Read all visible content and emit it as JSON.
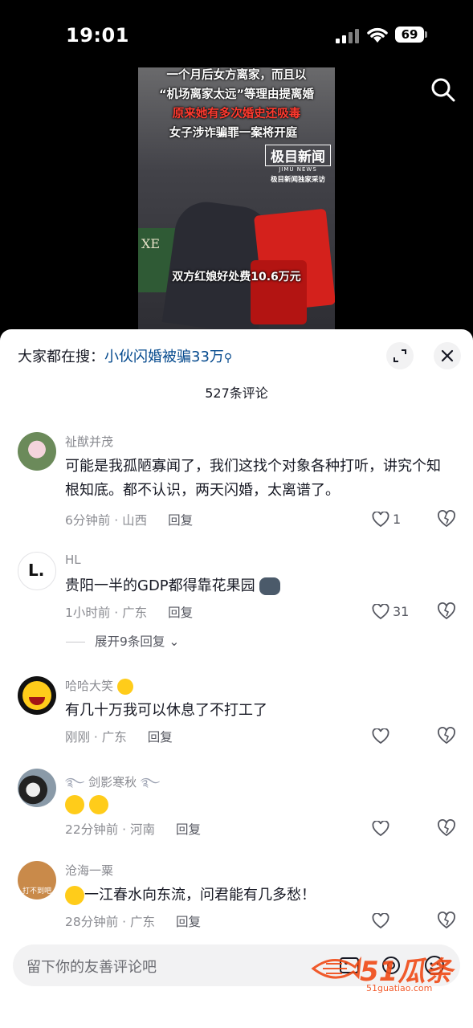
{
  "status_bar": {
    "time": "19:01",
    "battery": "69"
  },
  "video": {
    "captions": [
      "一个月后女方离家，而且以",
      "“机场离家太远”等理由提离婚",
      "原来她有多次婚史还吸毒",
      "女子涉诈骗罪一案将开庭"
    ],
    "logo_main": "极目新闻",
    "logo_en": "JIMU NEWS",
    "logo_sub": "极目新闻独家采访",
    "subtitle": "双方红娘好处费10.6万元",
    "bag_text": "XE"
  },
  "sheet": {
    "hot_prefix": "大家都在搜：",
    "hot_keyword": "小伙闪婚被骗33万",
    "comment_count": "527条评论"
  },
  "comments": [
    {
      "user": "祉猷并茂",
      "text": "可能是我孤陋寡闻了，我们这找个对象各种打听，讲究个知根知底。都不认识，两天闪婚，太离谱了。",
      "time_loc": "6分钟前 · 山西",
      "reply": "回复",
      "likes": "1"
    },
    {
      "user": "HL",
      "text": "贵阳一半的GDP都得靠花果园",
      "time_loc": "1小时前 · 广东",
      "reply": "回复",
      "likes": "31",
      "expand": "展开9条回复"
    },
    {
      "user": "哈哈大笑",
      "text": "有几十万我可以休息了不打工了",
      "time_loc": "刚刚 · 广东",
      "reply": "回复",
      "likes": ""
    },
    {
      "user": "剑影寒秋",
      "text": "",
      "time_loc": "22分钟前 · 河南",
      "reply": "回复",
      "likes": ""
    },
    {
      "user": "沧海一粟",
      "text": "一江春水向东流，问君能有几多愁！",
      "time_loc": "28分钟前 · 广东",
      "reply": "回复",
      "likes": ""
    }
  ],
  "avatar_texts": {
    "hl": "L.",
    "cat": "打不到吧"
  },
  "input": {
    "placeholder": "留下你的友善评论吧"
  },
  "watermark": {
    "brand": "51瓜条",
    "url": "51guatiao.com"
  },
  "colors": {
    "accent_link": "#04498d",
    "meta_gray": "#8a8b91",
    "watermark": "#f04a16"
  }
}
